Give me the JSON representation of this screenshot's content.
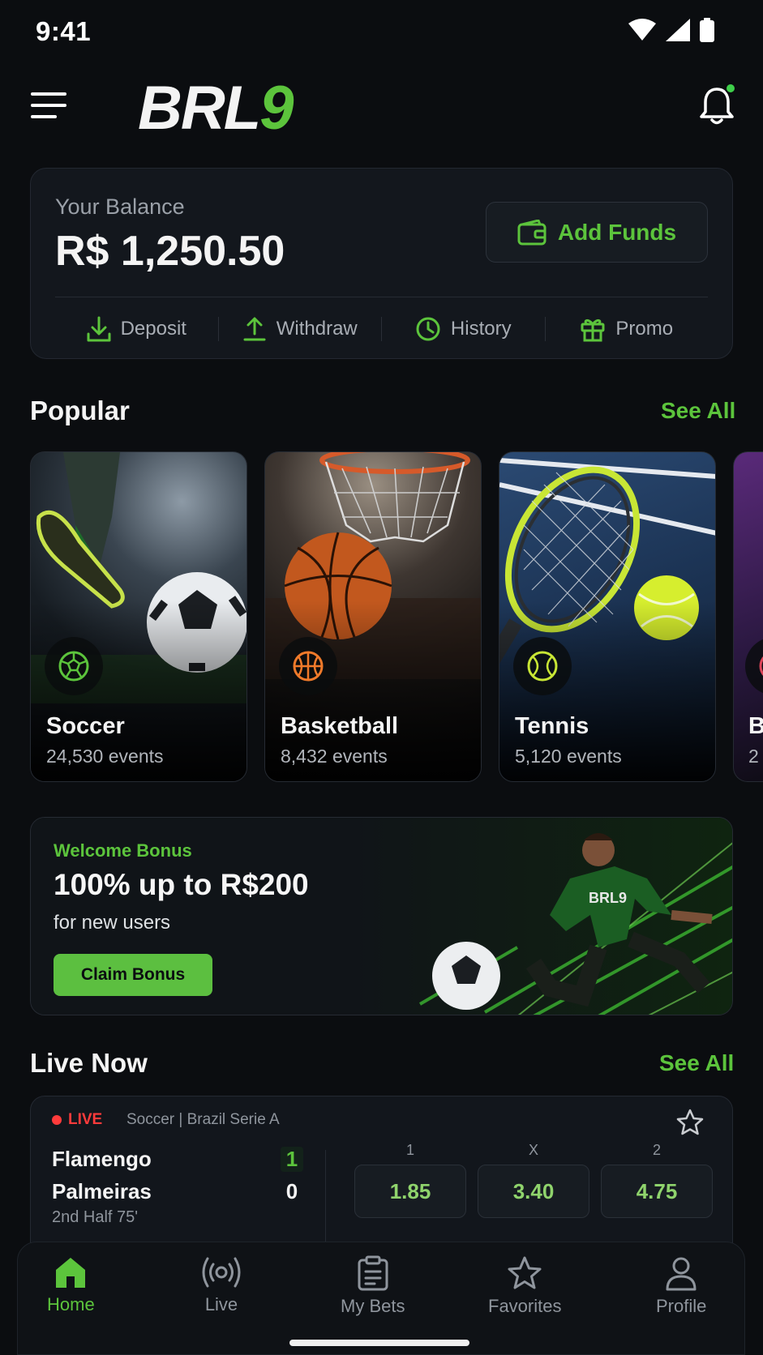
{
  "status_bar": {
    "time": "9:41"
  },
  "header": {
    "logo_main": "BRL",
    "logo_accent": "9"
  },
  "balance": {
    "label": "Your Balance",
    "value": "R$ 1,250.50",
    "add_funds_label": "Add Funds",
    "actions": [
      {
        "label": "Deposit",
        "icon": "download-icon"
      },
      {
        "label": "Withdraw",
        "icon": "upload-icon"
      },
      {
        "label": "History",
        "icon": "clock-icon"
      },
      {
        "label": "Promo",
        "icon": "gift-icon"
      }
    ]
  },
  "popular": {
    "title": "Popular",
    "see_all": "See All",
    "cards": [
      {
        "name": "Soccer",
        "events": "24,530 events",
        "icon": "soccer-ball-icon",
        "accent": "#5cc43c"
      },
      {
        "name": "Basketball",
        "events": "8,432 events",
        "icon": "basketball-icon",
        "accent": "#f07a2a"
      },
      {
        "name": "Tennis",
        "events": "5,120 events",
        "icon": "tennis-ball-icon",
        "accent": "#c8e635"
      },
      {
        "name": "B",
        "events": "2",
        "icon": "sport-icon",
        "accent": "#e0465b"
      }
    ]
  },
  "bonus": {
    "kicker": "Welcome Bonus",
    "title": "100% up to R$200",
    "subtitle": "for new users",
    "button": "Claim Bonus",
    "jersey_text": "BRL9"
  },
  "live": {
    "title": "Live  Now",
    "see_all": "See All",
    "match": {
      "status": "LIVE",
      "league": "Soccer | Brazil Serie A",
      "home_team": "Flamengo",
      "away_team": "Palmeiras",
      "home_score": "1",
      "away_score": "0",
      "time": "2nd Half 75'",
      "odds": [
        {
          "label": "1",
          "value": "1.85"
        },
        {
          "label": "X",
          "value": "3.40"
        },
        {
          "label": "2",
          "value": "4.75"
        }
      ]
    }
  },
  "bottom_nav": [
    {
      "label": "Home",
      "icon": "home-icon",
      "active": true
    },
    {
      "label": "Live",
      "icon": "broadcast-icon",
      "active": false
    },
    {
      "label": "My Bets",
      "icon": "clipboard-icon",
      "active": false
    },
    {
      "label": "Favorites",
      "icon": "star-icon",
      "active": false
    },
    {
      "label": "Profile",
      "icon": "user-icon",
      "active": false
    }
  ],
  "colors": {
    "accent": "#5cc43c",
    "live_red": "#ff3b3b",
    "background": "#0b0d10",
    "card": "#13171d"
  }
}
